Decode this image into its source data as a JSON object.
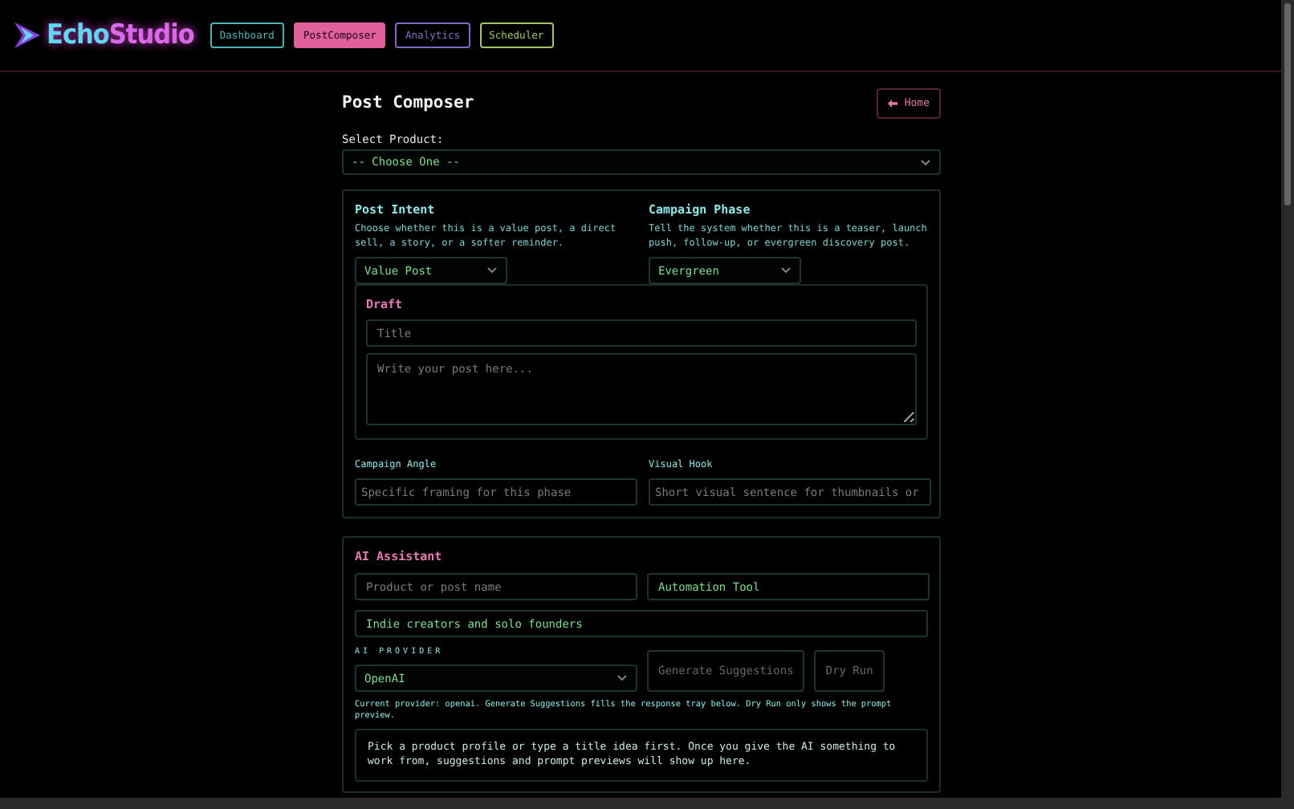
{
  "header": {
    "logo": {
      "first": "Echo",
      "second": "Studio"
    },
    "nav": [
      {
        "label": "Dashboard",
        "selected": false,
        "color": "#4fb3b3"
      },
      {
        "label": "PostComposer",
        "selected": true,
        "color": "#e0609c"
      },
      {
        "label": "Analytics",
        "selected": false,
        "color": "#7a6fc0"
      },
      {
        "label": "Scheduler",
        "selected": false,
        "color": "#a6c46a"
      }
    ]
  },
  "page": {
    "title": "Post Composer",
    "home_button": "Home"
  },
  "product_select": {
    "label": "Select Product:",
    "value": "-- Choose One --"
  },
  "post_intent": {
    "title": "Post Intent",
    "description": "Choose whether this is a value post, a direct sell, a story, or a softer reminder.",
    "value": "Value Post"
  },
  "campaign_phase": {
    "title": "Campaign Phase",
    "description": "Tell the system whether this is a teaser, launch push, follow-up, or evergreen discovery post.",
    "value": "Evergreen"
  },
  "draft": {
    "title": "Draft",
    "title_field": {
      "placeholder": "Title"
    },
    "body_field": {
      "placeholder": "Write your post here..."
    }
  },
  "campaign_angle": {
    "label": "Campaign Angle",
    "placeholder": "Specific framing for this phase"
  },
  "visual_hook": {
    "label": "Visual Hook",
    "placeholder": "Short visual sentence for thumbnails or"
  },
  "ai_assistant": {
    "title": "AI Assistant",
    "product_field": {
      "placeholder": "Product or post name"
    },
    "category_field": {
      "value": "Automation Tool"
    },
    "audience_field": {
      "value": "Indie creators and solo founders"
    },
    "provider": {
      "label": "AI PROVIDER",
      "value": "OpenAI"
    },
    "buttons": [
      {
        "label": "Generate Suggestions",
        "disabled": true
      },
      {
        "label": "Dry Run",
        "disabled": true
      }
    ],
    "note": "Current provider: openai. Generate Suggestions fills the response tray below. Dry Run only shows the prompt preview.",
    "response": "Pick a product profile or type a title idea first. Once you give the AI something to work from, suggestions and prompt previews will show up here."
  }
}
